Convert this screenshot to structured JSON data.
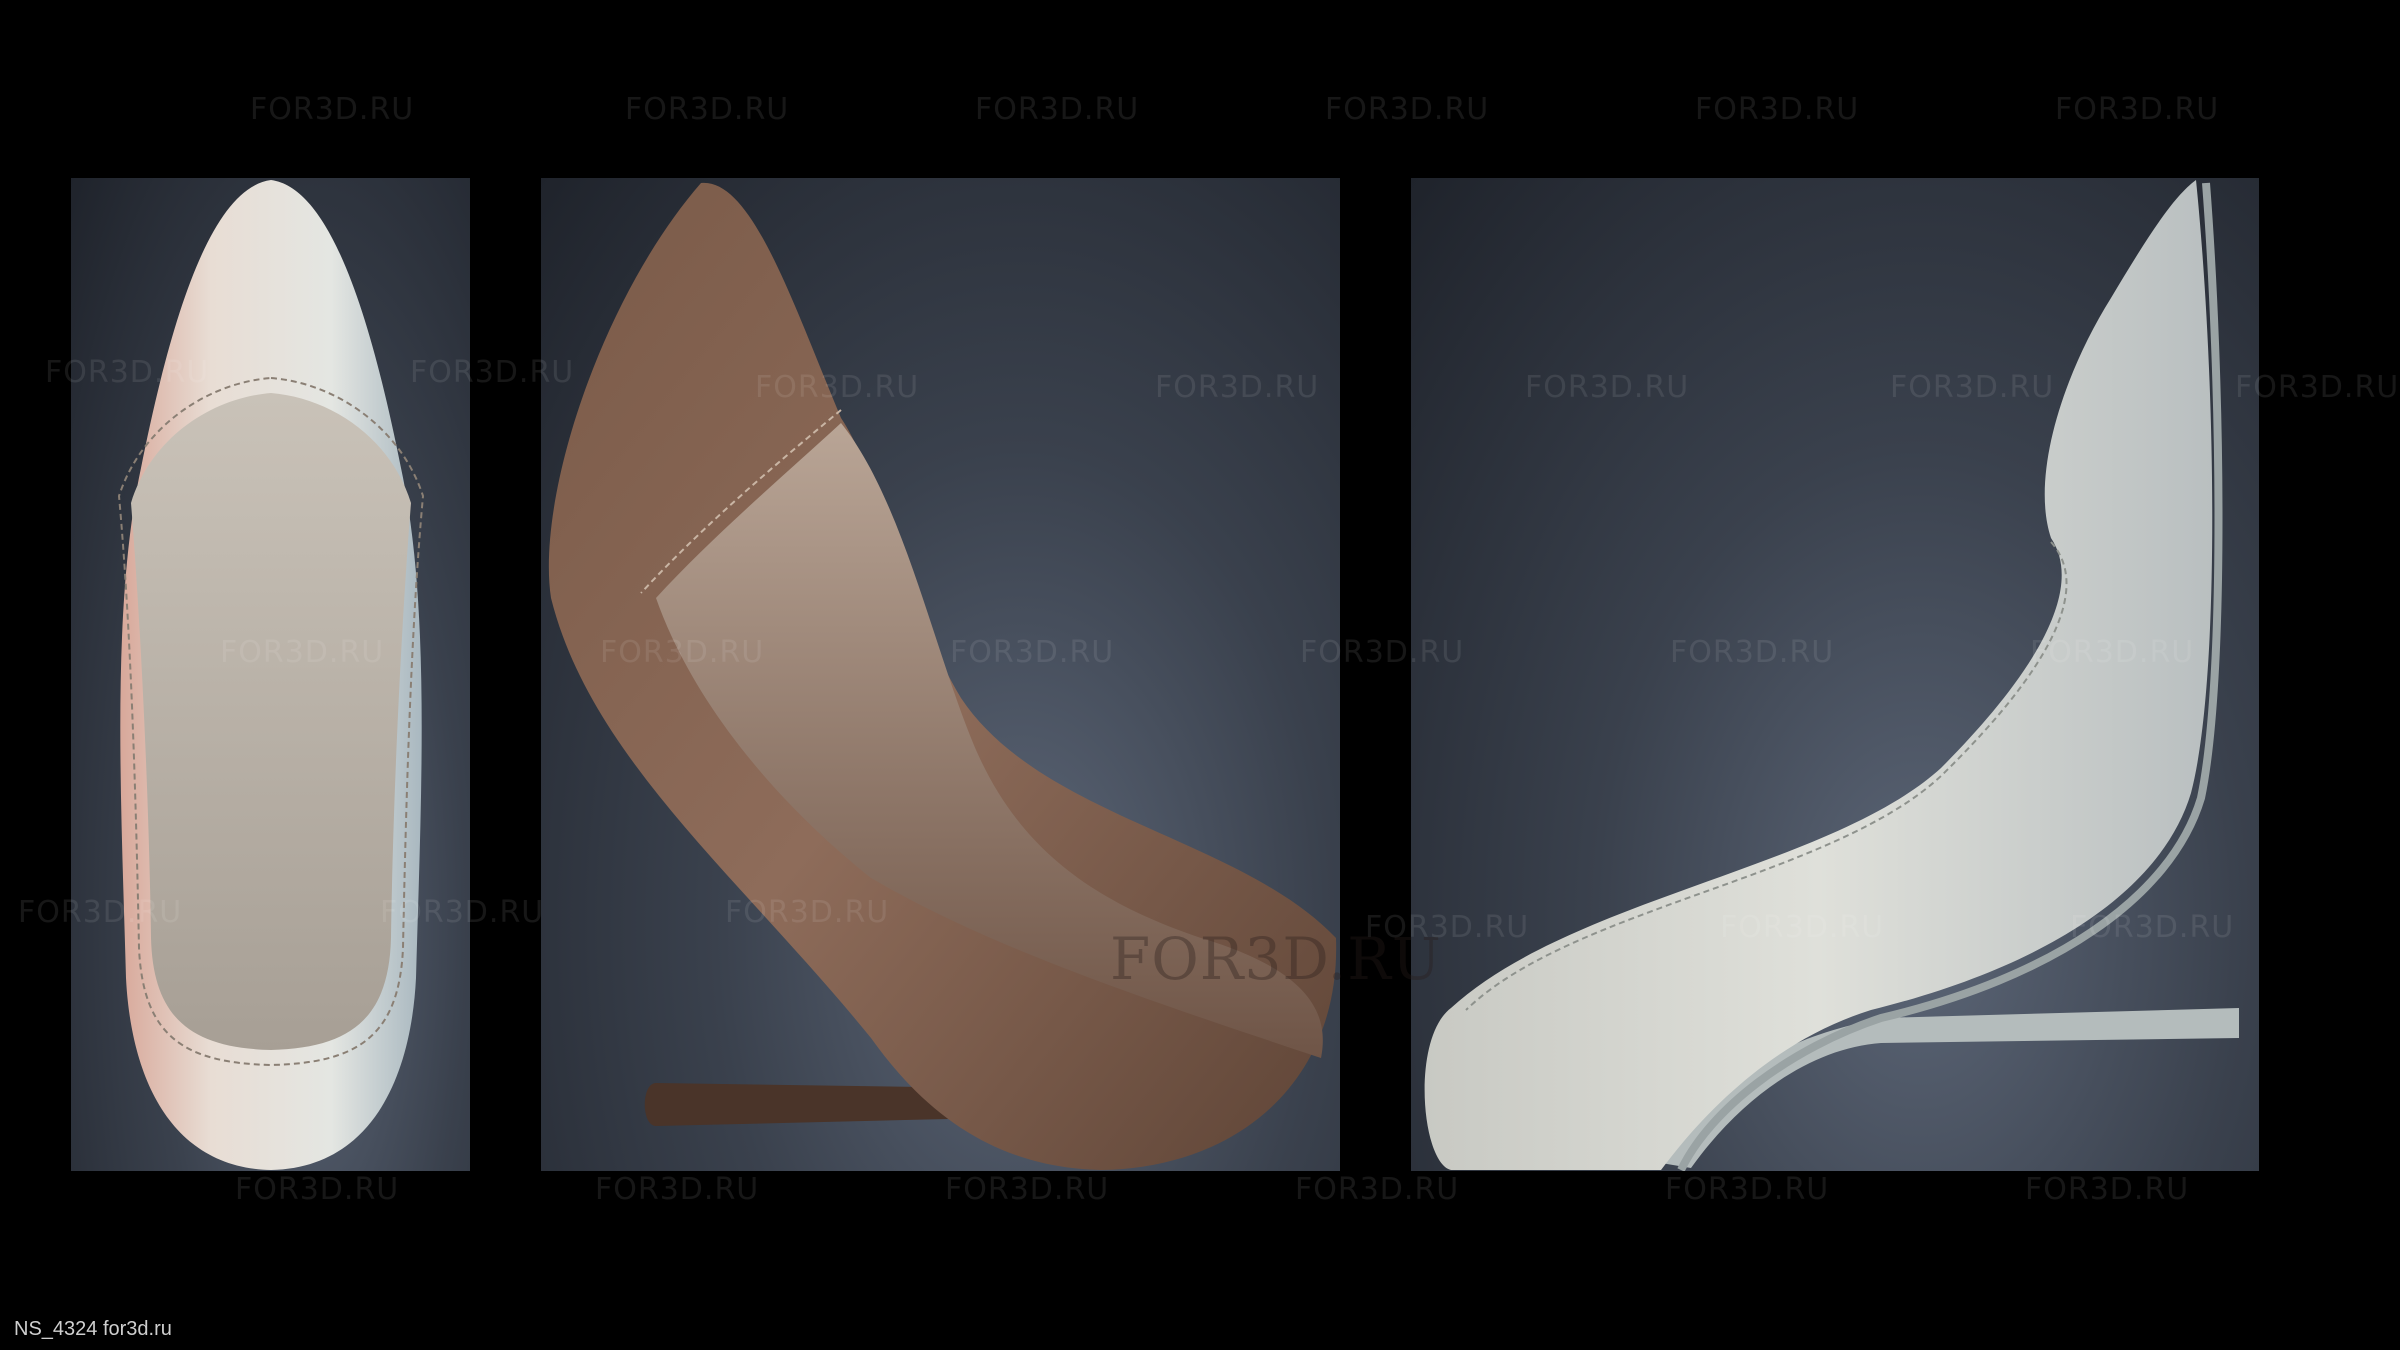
{
  "watermark": {
    "text": "FOR3D.RU",
    "feature_text": "FOR3D.RU"
  },
  "caption": {
    "text": "NS_4324 for3d.ru"
  },
  "panels": [
    {
      "name": "top-view",
      "label": ""
    },
    {
      "name": "three-quarter-view",
      "label": ""
    },
    {
      "name": "side-view",
      "label": ""
    }
  ]
}
